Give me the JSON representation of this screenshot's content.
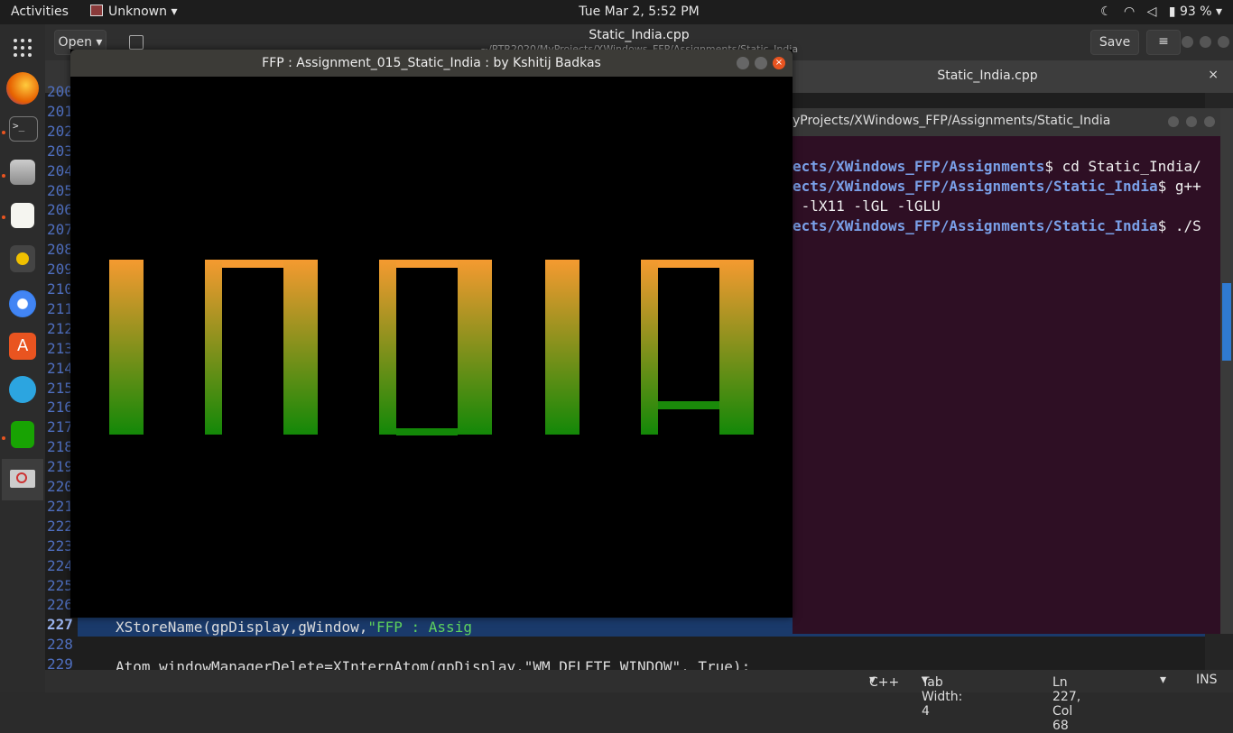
{
  "topbar": {
    "activities": "Activities",
    "app_menu": "Unknown",
    "clock": "Tue Mar  2,  5:52 PM",
    "battery": "93 %"
  },
  "dock": {
    "items": [
      "show-apps",
      "firefox",
      "terminal",
      "files",
      "text-editor",
      "rhythmbox",
      "chromium",
      "software-center",
      "telegram",
      "spreadsheet",
      "app-running"
    ]
  },
  "editor": {
    "open_label": "Open",
    "title": "Static_India.cpp",
    "subtitle": "~/RTR2020/MyProjects/XWindows_FFP/Assignments/Static_India",
    "save_label": "Save",
    "tab_label": "Static_India.cpp",
    "tab_close": "×",
    "line_numbers": [
      "200",
      "201",
      "202",
      "203",
      "204",
      "205",
      "206",
      "207",
      "208",
      "209",
      "210",
      "211",
      "212",
      "213",
      "214",
      "215",
      "216",
      "217",
      "218",
      "219",
      "220",
      "221",
      "222",
      "223",
      "224",
      "225",
      "226",
      "227",
      "228",
      "229"
    ],
    "line_227_code_a": "XStoreName(gpDisplay,gWindow,",
    "line_227_code_b": "\"FFP : Assig",
    "line_229_code": "Atom windowManagerDelete=XInternAtom(gpDisplay,\"WM_DELETE_WINDOW\", True);",
    "status": {
      "language": "C++",
      "tab_width": "Tab Width: 4",
      "cursor": "Ln 227, Col 68",
      "mode": "INS"
    }
  },
  "terminal": {
    "title": "yProjects/XWindows_FFP/Assignments/Static_India",
    "lines": [
      {
        "path": "ects/XWindows_FFP/Assignments",
        "cmd": "$ cd Static_India/"
      },
      {
        "path": "ects/XWindows_FFP/Assignments/Static_India",
        "cmd": "$ g++"
      },
      {
        "path": "",
        "cmd": " -lX11 -lGL -lGLU"
      },
      {
        "path": "ects/XWindows_FFP/Assignments/Static_India",
        "cmd": "$ ./S"
      }
    ]
  },
  "gl_window": {
    "title": "FFP : Assignment_015_Static_India : by Kshitij Badkas",
    "close_glyph": "×",
    "colors": {
      "saffron": "#f59a30",
      "green": "#138808",
      "background": "#000000"
    }
  }
}
